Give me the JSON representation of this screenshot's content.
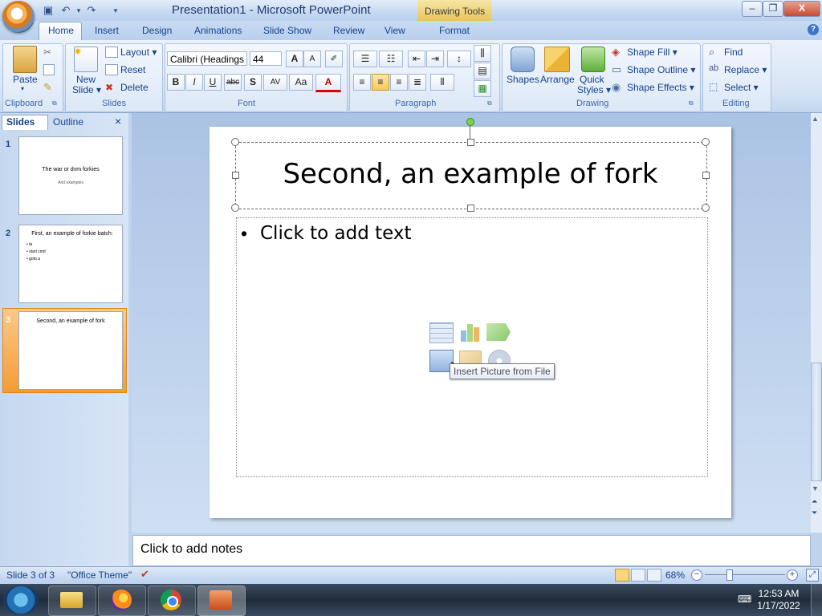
{
  "window": {
    "title": "Presentation1 - Microsoft PowerPoint",
    "contextual_tab_group": "Drawing Tools",
    "controls": {
      "minimize": "–",
      "restore": "❐",
      "close": "X"
    }
  },
  "quick_access": {
    "save_icon": "save-icon",
    "undo_icon": "undo-icon",
    "redo_icon": "redo-icon"
  },
  "tabs": [
    "Home",
    "Insert",
    "Design",
    "Animations",
    "Slide Show",
    "Review",
    "View",
    "Format"
  ],
  "ribbon": {
    "clipboard": {
      "label": "Clipboard",
      "paste": "Paste"
    },
    "slides": {
      "label": "Slides",
      "new_slide": "New",
      "new_slide2": "Slide ▾",
      "layout": "Layout ▾",
      "reset": "Reset",
      "delete": "Delete"
    },
    "font": {
      "label": "Font",
      "family": "Calibri (Headings",
      "size": "44",
      "bold": "B",
      "italic": "I",
      "underline": "U",
      "strike": "abc",
      "shadow": "S",
      "spacing": "AV",
      "case": "Aa",
      "color": "A",
      "grow": "A",
      "shrink": "A"
    },
    "paragraph": {
      "label": "Paragraph"
    },
    "drawing": {
      "label": "Drawing",
      "shapes": "Shapes",
      "arrange": "Arrange",
      "quick_styles": "Quick",
      "quick_styles2": "Styles ▾",
      "shape_fill": "Shape Fill ▾",
      "shape_outline": "Shape Outline ▾",
      "shape_effects": "Shape Effects ▾"
    },
    "editing": {
      "label": "Editing",
      "find": "Find",
      "replace": "Replace ▾",
      "select": "Select ▾"
    }
  },
  "left_pane": {
    "tab_slides": "Slides",
    "tab_outline": "Outline",
    "close": "×",
    "thumbnails": [
      {
        "num": "1",
        "title": "The war or dvm forkies",
        "sub": "And examples"
      },
      {
        "num": "2",
        "title": "First, an example of forkie batch:",
        "bullets": [
          "• ta",
          "• start cmd",
          "• goto a"
        ]
      },
      {
        "num": "3",
        "title": "Second, an example of fork"
      }
    ]
  },
  "slide": {
    "title": "Second, an example of fork",
    "body_placeholder": "Click to add text",
    "tooltip": "Insert Picture from File"
  },
  "notes": {
    "placeholder": "Click to add notes"
  },
  "status": {
    "slide": "Slide 3 of 3",
    "theme": "\"Office Theme\"",
    "zoom": "68%"
  },
  "clock": {
    "time": "12:53 AM",
    "date": "1/17/2022"
  }
}
